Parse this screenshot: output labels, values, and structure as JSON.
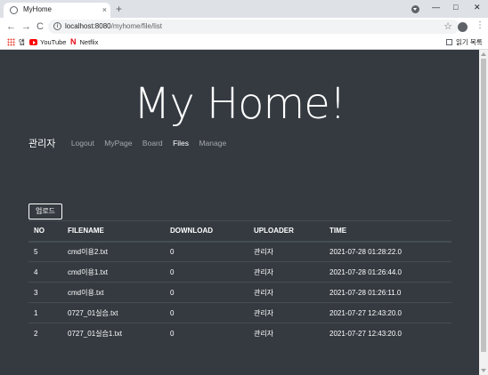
{
  "browser": {
    "tab_title": "MyHome",
    "tab_close": "×",
    "new_tab": "+",
    "controls": {
      "minimize": "—",
      "maximize": "□",
      "close": "✕"
    },
    "nav": {
      "back": "←",
      "forward": "→",
      "reload": "C"
    },
    "url_host": "localhost:8080",
    "url_path": "/myhome/file/list",
    "star": "☆",
    "menu": "⋮",
    "bookmarks": {
      "apps": "앱",
      "youtube": "YouTube",
      "netflix": "Netflix",
      "netflix_logo": "N",
      "reading_list": "읽기 목록"
    },
    "icons": [
      "page-icon",
      "info-icon",
      "star-icon",
      "profile-icon",
      "apps-icon",
      "youtube-icon",
      "netflix-icon",
      "reading-list-icon"
    ]
  },
  "page": {
    "hero_title": "My Home!",
    "nav": {
      "brand": "관리자",
      "links": [
        "Logout",
        "MyPage",
        "Board",
        "Files",
        "Manage"
      ],
      "active": "Files"
    },
    "upload_button": "업로드",
    "table": {
      "headers": [
        "NO",
        "FILENAME",
        "DOWNLOAD",
        "UPLOADER",
        "TIME"
      ],
      "rows": [
        [
          "5",
          "cmd이용2.txt",
          "0",
          "관리자",
          "2021-07-28 01:28:22.0"
        ],
        [
          "4",
          "cmd이용1.txt",
          "0",
          "관리자",
          "2021-07-28 01:26:44.0"
        ],
        [
          "3",
          "cmd이용.txt",
          "0",
          "관리자",
          "2021-07-28 01:26:11.0"
        ],
        [
          "1",
          "0727_01실습.txt",
          "0",
          "관리자",
          "2021-07-27 12:43:20.0"
        ],
        [
          "2",
          "0727_01실습1.txt",
          "0",
          "관리자",
          "2021-07-27 12:43:20.0"
        ]
      ]
    }
  },
  "colors": {
    "page_bg": "#343a40",
    "text": "#ffffff",
    "nav_muted": "rgba(255,255,255,0.55)",
    "table_border": "#454d55"
  }
}
